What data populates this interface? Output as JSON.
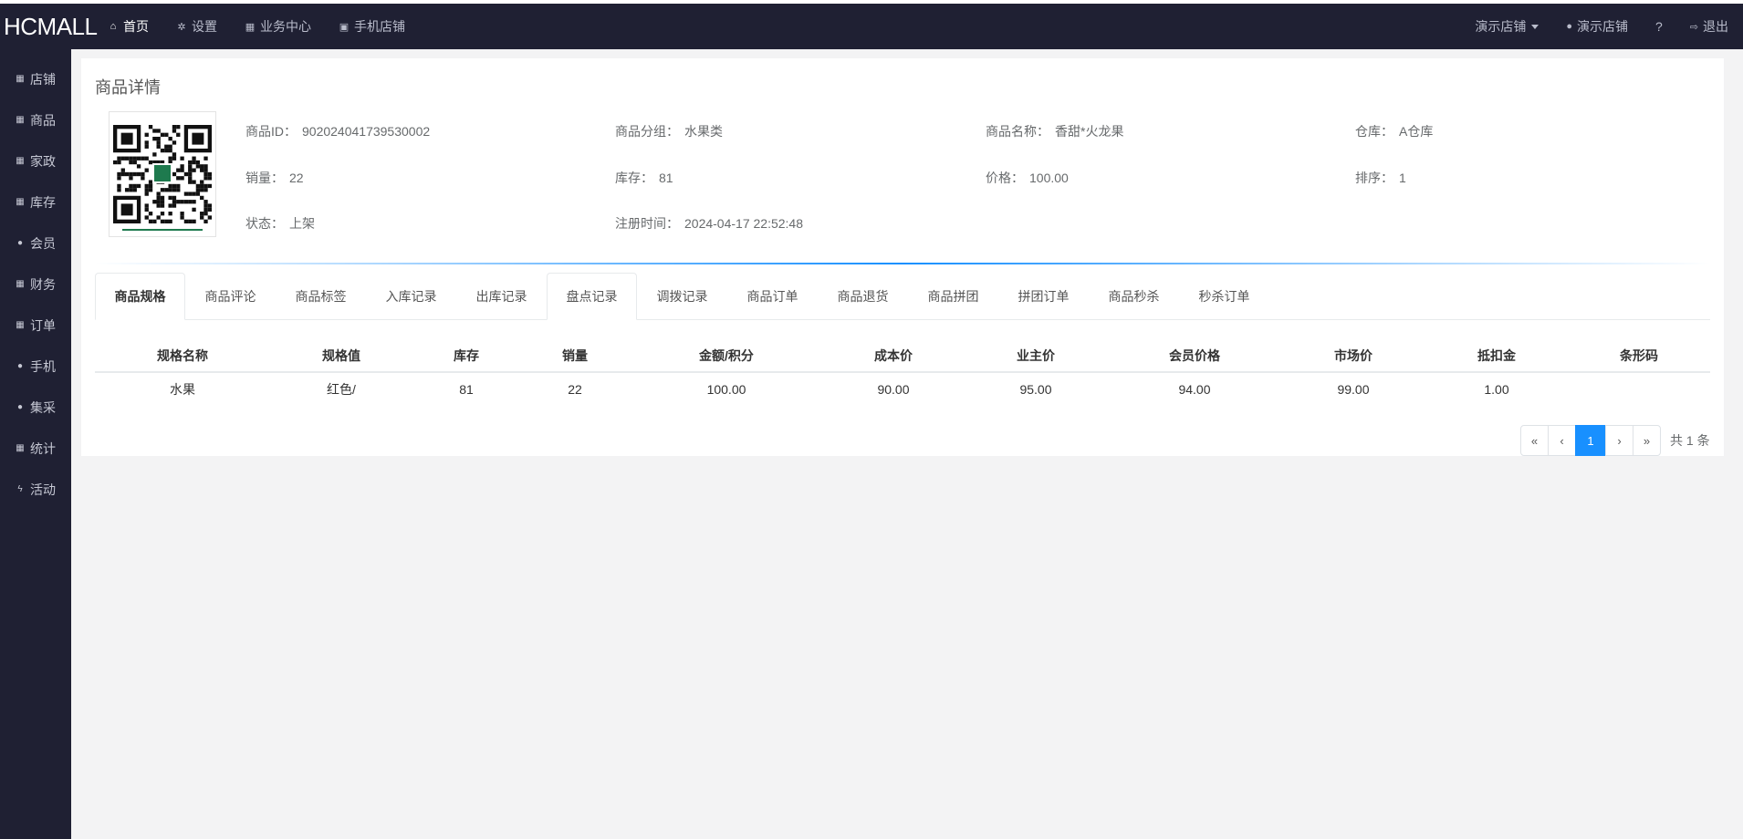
{
  "brand": "HCMALL",
  "top_nav": [
    {
      "label": "首页",
      "icon": "home-icon",
      "glyph": "⌂"
    },
    {
      "label": "设置",
      "icon": "gear-icon",
      "glyph": "✲"
    },
    {
      "label": "业务中心",
      "icon": "calculator-icon",
      "glyph": "▦"
    },
    {
      "label": "手机店铺",
      "icon": "qrcode-icon",
      "glyph": "▣"
    }
  ],
  "top_right": {
    "store_dropdown": "演示店铺",
    "user": "演示店铺",
    "help_glyph": "?",
    "logout": "退出"
  },
  "sidebar": [
    {
      "label": "店铺",
      "icon": "grid-icon",
      "glyph": "▦"
    },
    {
      "label": "商品",
      "icon": "grid-icon",
      "glyph": "▦"
    },
    {
      "label": "家政",
      "icon": "grid-icon",
      "glyph": "▦"
    },
    {
      "label": "库存",
      "icon": "grid-icon",
      "glyph": "▦"
    },
    {
      "label": "会员",
      "icon": "globe-icon",
      "glyph": "●"
    },
    {
      "label": "财务",
      "icon": "grid-icon",
      "glyph": "▦"
    },
    {
      "label": "订单",
      "icon": "grid-icon",
      "glyph": "▦"
    },
    {
      "label": "手机",
      "icon": "globe-icon",
      "glyph": "●"
    },
    {
      "label": "集采",
      "icon": "globe-icon",
      "glyph": "●"
    },
    {
      "label": "统计",
      "icon": "grid-icon",
      "glyph": "▦"
    },
    {
      "label": "活动",
      "icon": "bolt-icon",
      "glyph": "ϟ"
    }
  ],
  "panel_title": "商品详情",
  "info": {
    "product_id": {
      "label": "商品ID：",
      "value": "902024041739530002"
    },
    "group": {
      "label": "商品分组：",
      "value": "水果类"
    },
    "name": {
      "label": "商品名称：",
      "value": "香甜*火龙果"
    },
    "warehouse": {
      "label": "仓库：",
      "value": "A仓库"
    },
    "sales": {
      "label": "销量：",
      "value": "22"
    },
    "stock": {
      "label": "库存：",
      "value": "81"
    },
    "price": {
      "label": "价格：",
      "value": "100.00"
    },
    "sort": {
      "label": "排序：",
      "value": "1"
    },
    "status": {
      "label": "状态：",
      "value": "上架"
    },
    "reg_time": {
      "label": "注册时间：",
      "value": "2024-04-17 22:52:48"
    }
  },
  "tabs": [
    "商品规格",
    "商品评论",
    "商品标签",
    "入库记录",
    "出库记录",
    "盘点记录",
    "调拨记录",
    "商品订单",
    "商品退货",
    "商品拼团",
    "拼团订单",
    "商品秒杀",
    "秒杀订单"
  ],
  "table": {
    "headers": [
      "规格名称",
      "规格值",
      "库存",
      "销量",
      "金额/积分",
      "成本价",
      "业主价",
      "会员价格",
      "市场价",
      "抵扣金",
      "条形码"
    ],
    "rows": [
      [
        "水果",
        "红色/",
        "81",
        "22",
        "100.00",
        "90.00",
        "95.00",
        "94.00",
        "99.00",
        "1.00",
        ""
      ]
    ]
  },
  "pagination": {
    "first": "«",
    "prev": "‹",
    "current": "1",
    "next": "›",
    "last": "»",
    "total": "共 1 条"
  },
  "colors": {
    "accent": "#1890ff",
    "nav_bg": "#1f2033",
    "content_bg": "#f3f3f4"
  }
}
